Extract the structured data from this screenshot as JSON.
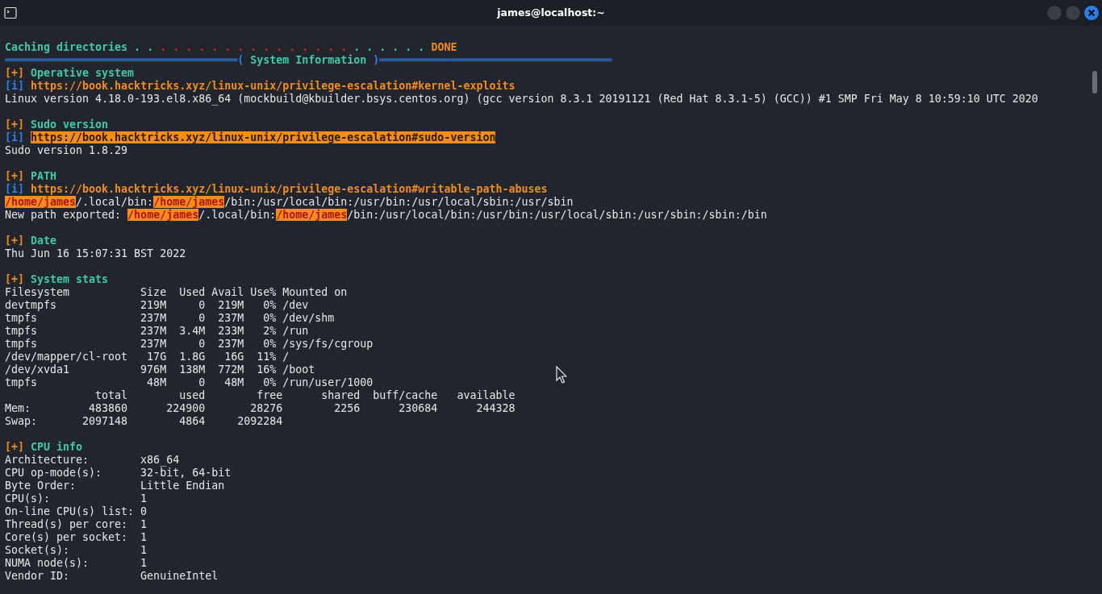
{
  "window": {
    "title": "james@localhost:~"
  },
  "lines": [
    {
      "kind": "text",
      "segments": [
        {
          "kind": "heading",
          "text": "Caching directories"
        },
        {
          "kind": "dots",
          "text": " . ."
        },
        {
          "kind": "dots_alert",
          "text": " . . . . . . . . . . . . . . ."
        },
        {
          "kind": "dots",
          "text": " . . . . . ."
        },
        {
          "kind": "link",
          "text": " DONE"
        }
      ]
    },
    {
      "kind": "text",
      "segments": [
        {
          "kind": "rule",
          "text": "════════════════════════════════════("
        },
        {
          "kind": "heading",
          "text": " System Information "
        },
        {
          "kind": "rule",
          "text": ")════════════════════════════════════"
        }
      ]
    },
    {
      "kind": "text",
      "segments": [
        {
          "kind": "marker",
          "text": "[+]"
        },
        {
          "kind": "heading",
          "text": " Operative system"
        }
      ]
    },
    {
      "kind": "text",
      "segments": [
        {
          "kind": "info",
          "text": "[i]"
        },
        {
          "kind": "link",
          "text": " https://book.hacktricks.xyz/linux-unix/privilege-escalation#kernel-exploits"
        }
      ]
    },
    {
      "kind": "text",
      "segments": [
        {
          "kind": "plain",
          "text": "Linux version 4.18.0-193.el8.x86_64 (mockbuild@kbuilder.bsys.centos.org) (gcc version 8.3.1 20191121 (Red Hat 8.3.1-5) (GCC)) #1 SMP Fri May 8 10:59:10 UTC 2020"
        }
      ]
    },
    {
      "kind": "blank"
    },
    {
      "kind": "text",
      "segments": [
        {
          "kind": "marker",
          "text": "[+]"
        },
        {
          "kind": "heading",
          "text": " Sudo version"
        }
      ]
    },
    {
      "kind": "text",
      "segments": [
        {
          "kind": "info",
          "text": "[i] "
        },
        {
          "kind": "highlight",
          "text": "https://book.hacktricks.xyz/linux-unix/privilege-escalation#sudo-version"
        }
      ]
    },
    {
      "kind": "text",
      "segments": [
        {
          "kind": "plain",
          "text": "Sudo version 1.8.29"
        }
      ]
    },
    {
      "kind": "blank"
    },
    {
      "kind": "text",
      "segments": [
        {
          "kind": "marker",
          "text": "[+]"
        },
        {
          "kind": "heading",
          "text": " PATH"
        }
      ]
    },
    {
      "kind": "text",
      "segments": [
        {
          "kind": "info",
          "text": "[i]"
        },
        {
          "kind": "link",
          "text": " https://book.hacktricks.xyz/linux-unix/privilege-escalation#writable-path-abuses"
        }
      ]
    },
    {
      "kind": "text",
      "segments": [
        {
          "kind": "alert",
          "text": "/home/james"
        },
        {
          "kind": "plain",
          "text": "/.local/bin:"
        },
        {
          "kind": "alert",
          "text": "/home/james"
        },
        {
          "kind": "plain",
          "text": "/bin:/usr/local/bin:/usr/bin:/usr/local/sbin:/usr/sbin"
        }
      ]
    },
    {
      "kind": "text",
      "segments": [
        {
          "kind": "plain",
          "text": "New path exported: "
        },
        {
          "kind": "alert",
          "text": "/home/james"
        },
        {
          "kind": "plain",
          "text": "/.local/bin:"
        },
        {
          "kind": "alert",
          "text": "/home/james"
        },
        {
          "kind": "plain",
          "text": "/bin:/usr/local/bin:/usr/bin:/usr/local/sbin:/usr/sbin:/sbin:/bin"
        }
      ]
    },
    {
      "kind": "blank"
    },
    {
      "kind": "text",
      "segments": [
        {
          "kind": "marker",
          "text": "[+]"
        },
        {
          "kind": "heading",
          "text": " Date"
        }
      ]
    },
    {
      "kind": "text",
      "segments": [
        {
          "kind": "plain",
          "text": "Thu Jun 16 15:07:31 BST 2022"
        }
      ]
    },
    {
      "kind": "blank"
    },
    {
      "kind": "text",
      "segments": [
        {
          "kind": "marker",
          "text": "[+]"
        },
        {
          "kind": "heading",
          "text": " System stats"
        }
      ]
    },
    {
      "kind": "text",
      "segments": [
        {
          "kind": "plain",
          "text": "Filesystem           Size  Used Avail Use% Mounted on"
        }
      ]
    },
    {
      "kind": "text",
      "segments": [
        {
          "kind": "plain",
          "text": "devtmpfs             219M     0  219M   0% /dev"
        }
      ]
    },
    {
      "kind": "text",
      "segments": [
        {
          "kind": "plain",
          "text": "tmpfs                237M     0  237M   0% /dev/shm"
        }
      ]
    },
    {
      "kind": "text",
      "segments": [
        {
          "kind": "plain",
          "text": "tmpfs                237M  3.4M  233M   2% /run"
        }
      ]
    },
    {
      "kind": "text",
      "segments": [
        {
          "kind": "plain",
          "text": "tmpfs                237M     0  237M   0% /sys/fs/cgroup"
        }
      ]
    },
    {
      "kind": "text",
      "segments": [
        {
          "kind": "plain",
          "text": "/dev/mapper/cl-root   17G  1.8G   16G  11% /"
        }
      ]
    },
    {
      "kind": "text",
      "segments": [
        {
          "kind": "plain",
          "text": "/dev/xvda1           976M  138M  772M  16% /boot"
        }
      ]
    },
    {
      "kind": "text",
      "segments": [
        {
          "kind": "plain",
          "text": "tmpfs                 48M     0   48M   0% /run/user/1000"
        }
      ]
    },
    {
      "kind": "text",
      "segments": [
        {
          "kind": "plain",
          "text": "              total        used        free      shared  buff/cache   available"
        }
      ]
    },
    {
      "kind": "text",
      "segments": [
        {
          "kind": "plain",
          "text": "Mem:         483860      224900       28276        2256      230684      244328"
        }
      ]
    },
    {
      "kind": "text",
      "segments": [
        {
          "kind": "plain",
          "text": "Swap:       2097148        4864     2092284"
        }
      ]
    },
    {
      "kind": "blank"
    },
    {
      "kind": "text",
      "segments": [
        {
          "kind": "marker",
          "text": "[+]"
        },
        {
          "kind": "heading",
          "text": " CPU info"
        }
      ]
    },
    {
      "kind": "text",
      "segments": [
        {
          "kind": "plain",
          "text": "Architecture:        x86_64"
        }
      ]
    },
    {
      "kind": "text",
      "segments": [
        {
          "kind": "plain",
          "text": "CPU op-mode(s):      32-bit, 64-bit"
        }
      ]
    },
    {
      "kind": "text",
      "segments": [
        {
          "kind": "plain",
          "text": "Byte Order:          Little Endian"
        }
      ]
    },
    {
      "kind": "text",
      "segments": [
        {
          "kind": "plain",
          "text": "CPU(s):              1"
        }
      ]
    },
    {
      "kind": "text",
      "segments": [
        {
          "kind": "plain",
          "text": "On-line CPU(s) list: 0"
        }
      ]
    },
    {
      "kind": "text",
      "segments": [
        {
          "kind": "plain",
          "text": "Thread(s) per core:  1"
        }
      ]
    },
    {
      "kind": "text",
      "segments": [
        {
          "kind": "plain",
          "text": "Core(s) per socket:  1"
        }
      ]
    },
    {
      "kind": "text",
      "segments": [
        {
          "kind": "plain",
          "text": "Socket(s):           1"
        }
      ]
    },
    {
      "kind": "text",
      "segments": [
        {
          "kind": "plain",
          "text": "NUMA node(s):        1"
        }
      ]
    },
    {
      "kind": "text",
      "segments": [
        {
          "kind": "plain",
          "text": "Vendor ID:           GenuineIntel"
        }
      ]
    }
  ]
}
